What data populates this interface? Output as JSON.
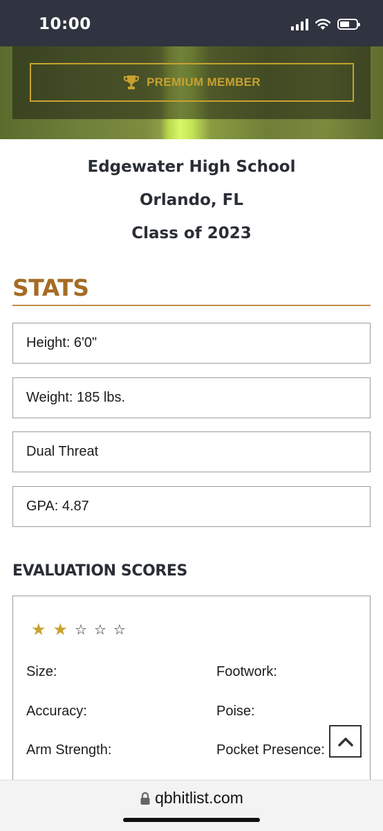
{
  "status_bar": {
    "time": "10:00",
    "icons": [
      "signal-icon",
      "wifi-icon",
      "battery-icon"
    ]
  },
  "hero": {
    "badge_icon": "trophy-icon",
    "badge_label": "PREMIUM MEMBER"
  },
  "profile": {
    "school": "Edgewater High School",
    "location": "Orlando, FL",
    "class_year": "Class of 2023"
  },
  "stats": {
    "heading": "STATS",
    "items": [
      "Height: 6'0\"",
      "Weight: 185 lbs.",
      "Dual Threat",
      "GPA: 4.87"
    ]
  },
  "evaluation": {
    "heading": "EVALUATION SCORES",
    "rating": 2,
    "rating_max": 5,
    "left_labels": [
      "Size:",
      "Accuracy:",
      "Arm Strength:"
    ],
    "right_labels": [
      "Footwork:",
      "Poise:",
      "Pocket Presence:"
    ]
  },
  "scroll_top": {
    "icon": "chevron-up-icon"
  },
  "browser": {
    "lock_icon": "lock-icon",
    "url": "qbhitlist.com"
  },
  "colors": {
    "accent_gold": "#c9a130",
    "stats_brown": "#a56b25",
    "status_bar_bg": "#2f3440"
  }
}
